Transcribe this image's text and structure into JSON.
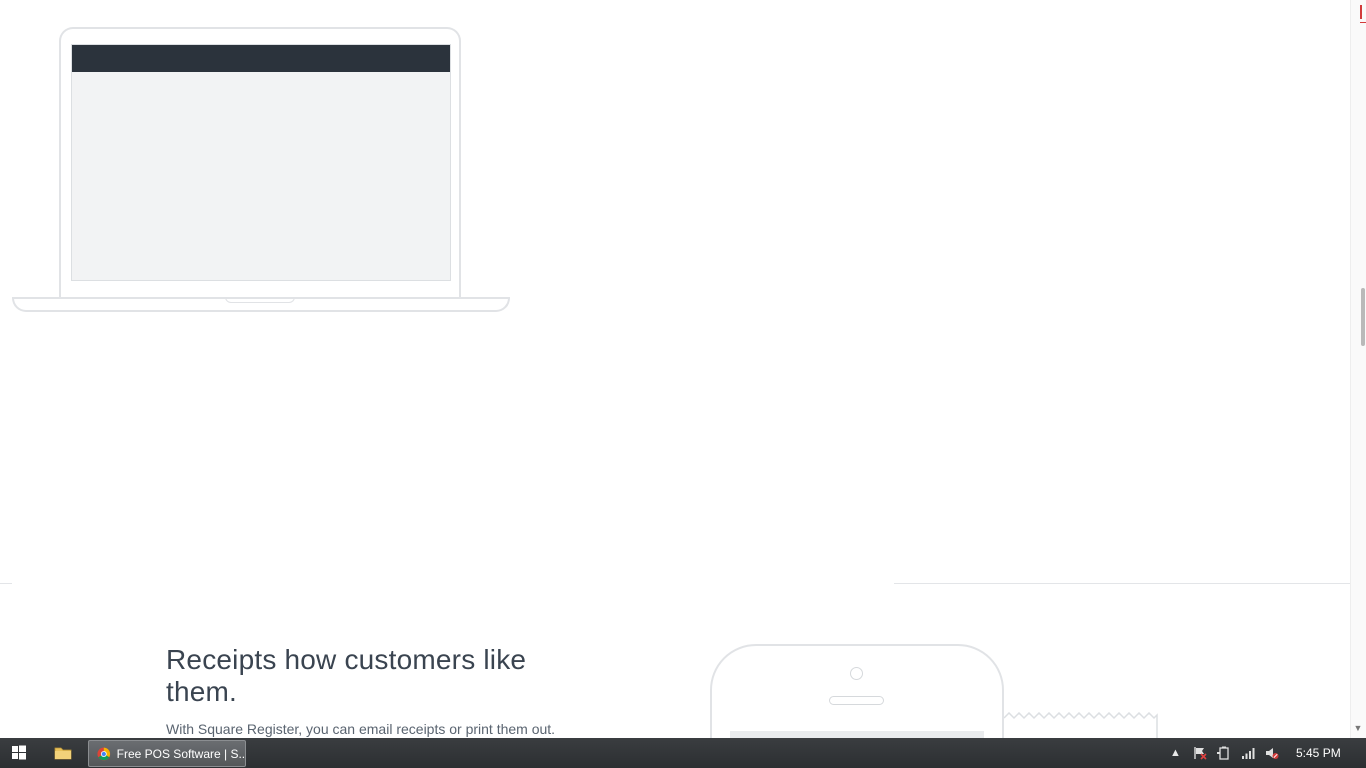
{
  "section": {
    "heading": "Receipts how customers like them.",
    "body": "With Square Register, you can email receipts or print them out."
  },
  "taskbar": {
    "start_icon": "windows-logo-icon",
    "explorer_icon": "folder-icon",
    "app_title": "Free POS Software | S...",
    "app_icon": "chrome-icon",
    "tray_icons": [
      "show-hidden-icons-arrow",
      "action-center-flag-icon",
      "power-icon",
      "network-signal-icon",
      "volume-muted-icon"
    ],
    "clock": "5:45 PM"
  },
  "colors": {
    "screen_header": "#2b333c",
    "screen_body": "#f2f3f4",
    "heading_text": "#3a4450",
    "taskbar": "#2c2f32"
  }
}
